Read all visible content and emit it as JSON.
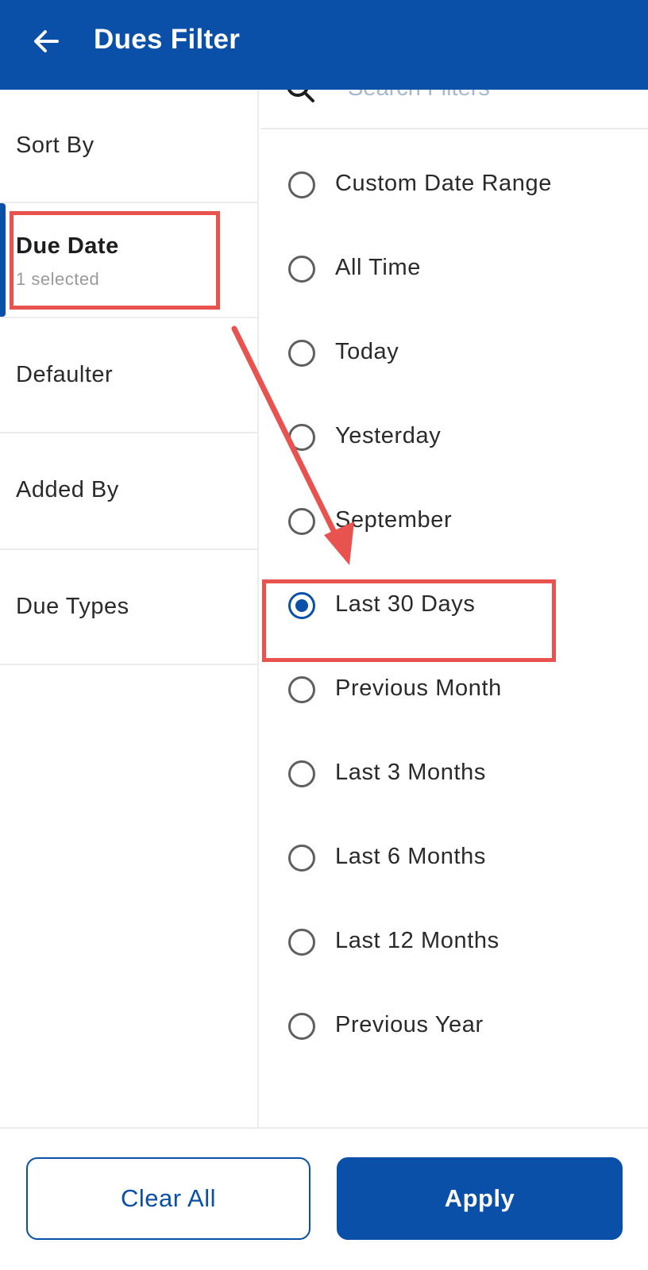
{
  "header": {
    "title": "Dues Filter",
    "back_icon": "arrow-left-icon",
    "background": "#0a4fa8"
  },
  "search": {
    "placeholder": "Search Filters",
    "icon": "search-icon"
  },
  "categories": [
    {
      "label": "Sort By",
      "sub": ""
    },
    {
      "label": "Due Date",
      "sub": "1 selected",
      "active": true
    },
    {
      "label": "Defaulter",
      "sub": ""
    },
    {
      "label": "Added By",
      "sub": ""
    },
    {
      "label": "Due Types",
      "sub": ""
    }
  ],
  "options": [
    {
      "label": "Custom Date Range",
      "checked": false
    },
    {
      "label": "All Time",
      "checked": false
    },
    {
      "label": "Today",
      "checked": false
    },
    {
      "label": "Yesterday",
      "checked": false
    },
    {
      "label": "September",
      "checked": false
    },
    {
      "label": "Last 30 Days",
      "checked": true
    },
    {
      "label": "Previous Month",
      "checked": false
    },
    {
      "label": "Last 3 Months",
      "checked": false
    },
    {
      "label": "Last 6 Months",
      "checked": false
    },
    {
      "label": "Last 12 Months",
      "checked": false
    },
    {
      "label": "Previous Year",
      "checked": false
    }
  ],
  "footer": {
    "clear_label": "Clear All",
    "apply_label": "Apply"
  },
  "colors": {
    "primary": "#0a4fa8",
    "annotation": "#e8524f"
  }
}
